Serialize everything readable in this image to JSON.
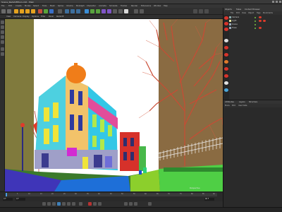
{
  "window": {
    "title": "Scene_RedshiftToon.c4d - Main"
  },
  "menubar": [
    "File",
    "Edit",
    "Create",
    "Modes",
    "Select",
    "Tools",
    "Mesh",
    "Spline",
    "Volume",
    "MoGraph",
    "Character",
    "Animate",
    "Simulate",
    "Tracker",
    "Render",
    "Extensions",
    "Window",
    "Help"
  ],
  "viewport_menu": [
    "View",
    "Cameras",
    "Display",
    "Options",
    "Filter",
    "Panel",
    "Redshift"
  ],
  "viewport": {
    "label": "Perspective"
  },
  "timeline": {
    "ticks": [
      "0",
      "5",
      "10",
      "15",
      "20",
      "25",
      "30",
      "35",
      "40",
      "45",
      "50",
      "55",
      "60",
      "65",
      "70",
      "75",
      "80",
      "85",
      "90"
    ],
    "start_frame": "0 F",
    "current_frame": "0 F",
    "end_frame": "90 F"
  },
  "right_panel": {
    "tabs": [
      "Objects",
      "Takes",
      "Content Browser"
    ],
    "menu": [
      "File",
      "Edit",
      "View",
      "Object",
      "Tags",
      "Bookmarks"
    ],
    "objects": [
      {
        "name": "Camera"
      },
      {
        "name": "Light"
      },
      {
        "name": "Scene"
      },
      {
        "name": "Trees"
      }
    ]
  },
  "attributes": {
    "tabs": [
      "Attributes",
      "Layers",
      "Structure"
    ],
    "menu": [
      "Mode",
      "Edit",
      "User Data"
    ]
  },
  "colors": {
    "accent": "#3e7fb8",
    "tag_red": "#e23b2b",
    "ui_bg": "#2b2b2b"
  }
}
